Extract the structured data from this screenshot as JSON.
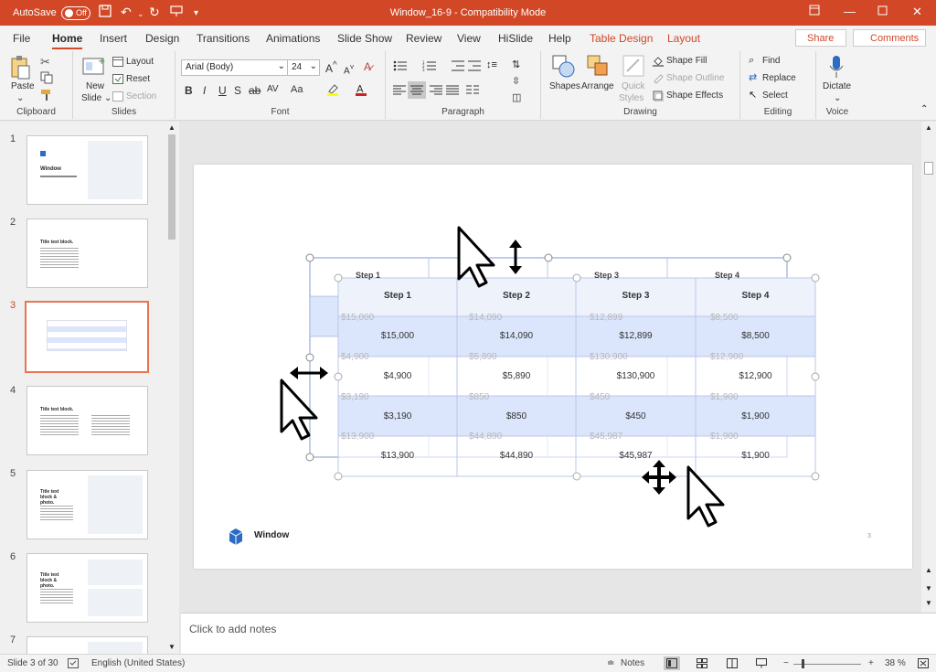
{
  "titlebar": {
    "autosave_label": "AutoSave",
    "autosave_state": "Off",
    "document_title": "Window_16-9  -  Compatibility Mode"
  },
  "tabs": {
    "file": "File",
    "home": "Home",
    "insert": "Insert",
    "design": "Design",
    "transitions": "Transitions",
    "animations": "Animations",
    "slideshow": "Slide Show",
    "review": "Review",
    "view": "View",
    "hislide": "HiSlide",
    "help": "Help",
    "tabledesign": "Table Design",
    "layout": "Layout"
  },
  "actions": {
    "share": "Share",
    "comments": "Comments"
  },
  "ribbon": {
    "clipboard": {
      "paste": "Paste",
      "label": "Clipboard"
    },
    "slides": {
      "new_slide_1": "New",
      "new_slide_2": "Slide",
      "layout": "Layout",
      "reset": "Reset",
      "section": "Section",
      "label": "Slides"
    },
    "font": {
      "font_name": "Arial (Body)",
      "font_size": "24",
      "label": "Font"
    },
    "paragraph": {
      "label": "Paragraph"
    },
    "drawing": {
      "shapes": "Shapes",
      "arrange": "Arrange",
      "quick_1": "Quick",
      "quick_2": "Styles",
      "shape_fill": "Shape Fill",
      "shape_outline": "Shape Outline",
      "shape_effects": "Shape Effects",
      "label": "Drawing"
    },
    "editing": {
      "find": "Find",
      "replace": "Replace",
      "select": "Select",
      "label": "Editing"
    },
    "voice": {
      "dictate": "Dictate",
      "label": "Voice"
    }
  },
  "slides_panel": {
    "numbers": [
      "1",
      "2",
      "3",
      "4",
      "5",
      "6",
      "7"
    ],
    "thumb_titles": [
      "Window",
      "Title text block.",
      "",
      "Title text block.",
      "Title text block & photo.",
      "Title text block & photo.",
      ""
    ]
  },
  "slide": {
    "logo_text": "Window",
    "page_number": "3"
  },
  "table": {
    "headers": [
      "Step 1",
      "Step 2",
      "Step 3",
      "Step 4"
    ],
    "rows": [
      [
        "$15,000",
        "$14,090",
        "$12,899",
        "$8,500"
      ],
      [
        "$4,900",
        "$5,890",
        "$130,900",
        "$12,900"
      ],
      [
        "$3,190",
        "$850",
        "$450",
        "$1,900"
      ],
      [
        "$13,900",
        "$44,890",
        "$45,987",
        "$1,900"
      ]
    ]
  },
  "notes": {
    "placeholder": "Click to add notes"
  },
  "status": {
    "slide_count": "Slide 3 of 30",
    "language": "English (United States)",
    "notes": "Notes",
    "zoom": "38 %"
  },
  "colors": {
    "accent": "#d24726",
    "table_band": "#dbe5fb",
    "table_header": "#eef2fb"
  }
}
